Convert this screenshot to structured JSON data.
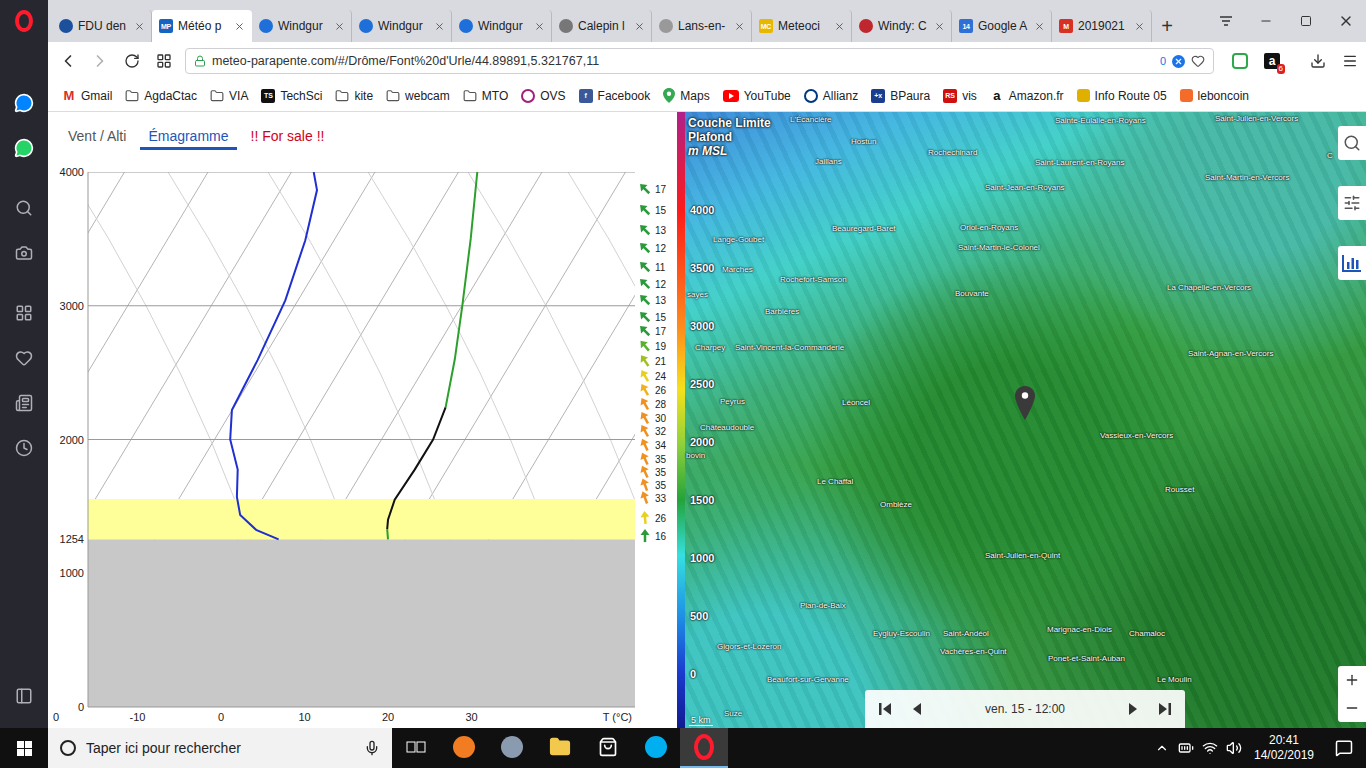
{
  "browser": {
    "tabs": [
      {
        "label": "FDU den",
        "selected": false,
        "favicon": "",
        "favicon_color": "#1c4f9c"
      },
      {
        "label": "Météo p",
        "selected": true,
        "favicon": "MP",
        "favicon_color": "#1565c0"
      },
      {
        "label": "Windgur",
        "selected": false,
        "favicon": "",
        "favicon_color": "#1e6fd9"
      },
      {
        "label": "Windgur",
        "selected": false,
        "favicon": "",
        "favicon_color": "#1e6fd9"
      },
      {
        "label": "Windgur",
        "selected": false,
        "favicon": "",
        "favicon_color": "#1e6fd9"
      },
      {
        "label": "Calepin l",
        "selected": false,
        "favicon": "",
        "favicon_color": "#777777"
      },
      {
        "label": "Lans-en-",
        "selected": false,
        "favicon": "",
        "favicon_color": "#999999"
      },
      {
        "label": "Meteoci",
        "selected": false,
        "favicon": "MC",
        "favicon_color": "#e8b800"
      },
      {
        "label": "Windy: C",
        "selected": false,
        "favicon": "",
        "favicon_color": "#c0262d"
      },
      {
        "label": "Google A",
        "selected": false,
        "favicon": "14",
        "favicon_color": "#2f6fd6"
      },
      {
        "label": "2019021",
        "selected": false,
        "favicon": "M",
        "favicon_color": "#d93025"
      }
    ],
    "new_tab": "+",
    "address": {
      "url": "meteo-parapente.com/#/Drôme/Font%20d'Urle/44.89891,5.321767,11",
      "blocked_count": "0"
    },
    "extension": {
      "letter": "a",
      "badge": "6"
    },
    "bookmarks": [
      {
        "label": "Gmail",
        "kind": "letter",
        "icon_text": "M",
        "color": "#d93025"
      },
      {
        "label": "AgdaCtac",
        "kind": "folder",
        "icon_text": "",
        "color": "#555555"
      },
      {
        "label": "VIA",
        "kind": "folder",
        "icon_text": "",
        "color": "#555555"
      },
      {
        "label": "TechSci",
        "kind": "badge",
        "icon_text": "TS",
        "color": "#111111"
      },
      {
        "label": "kite",
        "kind": "folder",
        "icon_text": "",
        "color": "#555555"
      },
      {
        "label": "webcam",
        "kind": "folder",
        "icon_text": "",
        "color": "#555555"
      },
      {
        "label": "MTO",
        "kind": "folder",
        "icon_text": "",
        "color": "#555555"
      },
      {
        "label": "OVS",
        "kind": "ring",
        "icon_text": "",
        "color": "#a0207a"
      },
      {
        "label": "Facebook",
        "kind": "badge",
        "icon_text": "f",
        "color": "#3b5998"
      },
      {
        "label": "Maps",
        "kind": "pin",
        "icon_text": "",
        "color": "#34a853"
      },
      {
        "label": "YouTube",
        "kind": "play",
        "icon_text": "",
        "color": "#ff0000"
      },
      {
        "label": "Allianz",
        "kind": "ring",
        "icon_text": "",
        "color": "#003781"
      },
      {
        "label": "BPaura",
        "kind": "badge",
        "icon_text": "+x",
        "color": "#1a3d8f"
      },
      {
        "label": "vis",
        "kind": "badge",
        "icon_text": "RS",
        "color": "#d01010"
      },
      {
        "label": "Amazon.fr",
        "kind": "letter",
        "icon_text": "a",
        "color": "#111111"
      },
      {
        "label": "Info Route 05",
        "kind": "square",
        "icon_text": "",
        "color": "#e0b000"
      },
      {
        "label": "leboncoin",
        "kind": "square",
        "icon_text": "",
        "color": "#f56b2a"
      }
    ]
  },
  "page_tabs": [
    {
      "label": "Vent / Alti",
      "selected": false,
      "color": "#555555"
    },
    {
      "label": "Émagramme",
      "selected": true,
      "color": "#1e56b8"
    },
    {
      "label": "!! For sale !!",
      "selected": false,
      "color": "#d0021b"
    }
  ],
  "emagram": {
    "y_ticks": [
      {
        "label": "4000",
        "value": 4000
      },
      {
        "label": "3000",
        "value": 3000
      },
      {
        "label": "2000",
        "value": 2000
      },
      {
        "label": "1000",
        "value": 1000
      },
      {
        "label": "0",
        "value": 0
      }
    ],
    "x_ticks": [
      {
        "label": "0",
        "value": -20
      },
      {
        "label": "-10",
        "value": -10
      },
      {
        "label": "0",
        "value": 0
      },
      {
        "label": "10",
        "value": 10
      },
      {
        "label": "20",
        "value": 20
      },
      {
        "label": "30",
        "value": 30
      }
    ],
    "x_label": "T (°C)",
    "surface": {
      "label": "1254",
      "alt": 1254
    },
    "thermal_top_alt": 1555,
    "dewpoint": {
      "color": "#1f2fd0",
      "points": [
        [
          4000,
          11.1
        ],
        [
          3865,
          11.5
        ],
        [
          3490,
          10.1
        ],
        [
          3040,
          7.7
        ],
        [
          2595,
          4.4
        ],
        [
          2220,
          1.3
        ],
        [
          2000,
          1.1
        ],
        [
          1775,
          2.0
        ],
        [
          1570,
          1.9
        ],
        [
          1435,
          2.3
        ],
        [
          1325,
          4.2
        ],
        [
          1254,
          6.9
        ]
      ]
    },
    "temperature": [
      {
        "color": "#2ca02c",
        "points": [
          [
            4000,
            30.7
          ],
          [
            3500,
            29.9
          ],
          [
            3000,
            28.9
          ],
          [
            2600,
            28.0
          ],
          [
            2240,
            26.9
          ]
        ]
      },
      {
        "color": "#111111",
        "points": [
          [
            2240,
            26.9
          ],
          [
            2000,
            25.4
          ],
          [
            1775,
            23.2
          ],
          [
            1550,
            20.8
          ],
          [
            1400,
            20.0
          ],
          [
            1330,
            19.9
          ]
        ]
      },
      {
        "color": "#2ca02c",
        "points": [
          [
            1330,
            19.9
          ],
          [
            1254,
            20.0
          ]
        ]
      }
    ],
    "winds": [
      {
        "speed": "17",
        "alt": 3873,
        "dir": -45,
        "color": "#2a9a3a"
      },
      {
        "speed": "15",
        "alt": 3716,
        "dir": -45,
        "color": "#2a9a3a"
      },
      {
        "speed": "13",
        "alt": 3566,
        "dir": -45,
        "color": "#2a9a3a"
      },
      {
        "speed": "12",
        "alt": 3432,
        "dir": -45,
        "color": "#2a9a3a"
      },
      {
        "speed": "11",
        "alt": 3290,
        "dir": -45,
        "color": "#2a9a3a"
      },
      {
        "speed": "12",
        "alt": 3163,
        "dir": -45,
        "color": "#2a9a3a"
      },
      {
        "speed": "13",
        "alt": 3043,
        "dir": -45,
        "color": "#2a9a3a"
      },
      {
        "speed": "15",
        "alt": 2916,
        "dir": -45,
        "color": "#2a9a3a"
      },
      {
        "speed": "17",
        "alt": 2811,
        "dir": -45,
        "color": "#2a9a3a"
      },
      {
        "speed": "19",
        "alt": 2699,
        "dir": -40,
        "color": "#5bb030"
      },
      {
        "speed": "21",
        "alt": 2587,
        "dir": -35,
        "color": "#a0c020"
      },
      {
        "speed": "24",
        "alt": 2475,
        "dir": -30,
        "color": "#e8d020"
      },
      {
        "speed": "26",
        "alt": 2370,
        "dir": -30,
        "color": "#f0b020"
      },
      {
        "speed": "28",
        "alt": 2265,
        "dir": -30,
        "color": "#f09020"
      },
      {
        "speed": "30",
        "alt": 2160,
        "dir": -30,
        "color": "#f09020"
      },
      {
        "speed": "32",
        "alt": 2063,
        "dir": -30,
        "color": "#f09020"
      },
      {
        "speed": "34",
        "alt": 1959,
        "dir": -25,
        "color": "#f09020"
      },
      {
        "speed": "35",
        "alt": 1854,
        "dir": -25,
        "color": "#f09020"
      },
      {
        "speed": "35",
        "alt": 1757,
        "dir": -25,
        "color": "#f09020"
      },
      {
        "speed": "35",
        "alt": 1660,
        "dir": -20,
        "color": "#f09020"
      },
      {
        "speed": "33",
        "alt": 1563,
        "dir": -20,
        "color": "#f09020"
      },
      {
        "speed": "26",
        "alt": 1413,
        "dir": -5,
        "color": "#e8d020"
      },
      {
        "speed": "16",
        "alt": 1278,
        "dir": 0,
        "color": "#2a9a3a"
      }
    ]
  },
  "map": {
    "title": [
      "Couche Limite",
      "Plafond",
      "m MSL"
    ],
    "legend": [
      "4000",
      "3500",
      "3000",
      "2500",
      "2000",
      "1500",
      "1000",
      "500",
      "0"
    ],
    "places": [
      "L'Écancière",
      "Hostun",
      "Rochechinard",
      "Jaillans",
      "Sainte-Eulalie-en-Royans",
      "Saint-Julien-en-Vercors",
      "Saint-Laurent-en-Royans",
      "Saint-Martin-en-Vercors",
      "Saint-Jean-en-Royans",
      "C",
      "Lange-Goubet",
      "Beauregard-Baret",
      "Oriol-en-Royans",
      "Saint-Martin-le-Colonel",
      "Marches",
      "Rochefort-Samson",
      "Bouvante",
      "La Chapelle-en-Vercors",
      "sayes",
      "Barbières",
      "Charpey",
      "Saint-Vincent-la-Commanderie",
      "Saint-Agnan-en-Vercors",
      "Peyrus",
      "Léoncel",
      "Châteaudouble",
      "bovin",
      "Vassieux-en-Vercors",
      "Le Chaffal",
      "Rousset",
      "Omblèze",
      "Saint-Julien-en-Quint",
      "Plan-de-Baix",
      "Eygluy-Escoulin",
      "Saint-Andéol",
      "Marignac-en-Diois",
      "Chamaloc",
      "Gigors-et-Lozeron",
      "Vachères-en-Quint",
      "Ponet-et-Saint-Auban",
      "Beaufort-sur-Gervanne",
      "Le Moulin",
      "Suze"
    ],
    "time": "ven. 15 - 12:00",
    "scale": "5 km"
  },
  "taskbar": {
    "search_placeholder": "Taper ici pour rechercher",
    "time": "20:41",
    "date": "14/02/2019"
  }
}
